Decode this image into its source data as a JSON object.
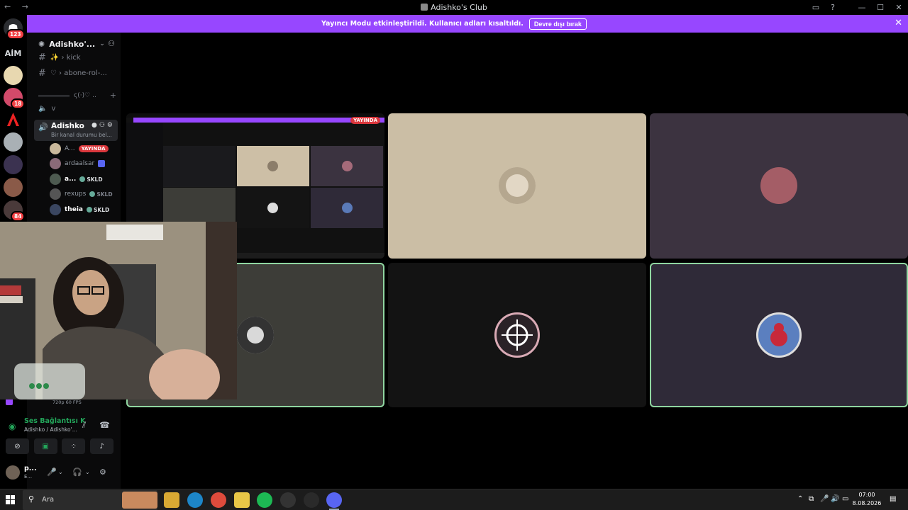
{
  "window": {
    "title": "Adishko's Club",
    "nav": "← →"
  },
  "banner": {
    "message": "Yayıncı Modu etkinleştirildi. Kullanıcı adları kısaltıldı.",
    "button": "Devre dışı bırak"
  },
  "rail": {
    "home_badge": "123",
    "aim_label": "AİM",
    "badge_18": "18",
    "badge_84": "84"
  },
  "server": {
    "name": "Adishko'...",
    "channels": [
      {
        "label": "✨ › kick"
      },
      {
        "label": "♡ › abone-rol-..."
      }
    ],
    "category": "ς(·)♡ ..",
    "voice_v": "v"
  },
  "voice_channel": {
    "name": "Adishko",
    "status": "Bir kanal durumu bel..."
  },
  "voice_users": [
    {
      "name": "A...",
      "tag": "YAYINDA"
    },
    {
      "name": "ardaalsar"
    },
    {
      "name": "a...",
      "tag": "SKLD"
    },
    {
      "name": "rexups",
      "tag": "SKLD"
    },
    {
      "name": "theia",
      "tag": "SKLD"
    }
  ],
  "stream_panel": {
    "quality": "720p 60 FPS"
  },
  "voice_connection": {
    "title": "Ses Bağlantısı K",
    "subtitle": "Adishko / Adishko'..."
  },
  "user_panel": {
    "name": "p...",
    "sub": "E..."
  },
  "live_label": "YAYINDA",
  "taskbar": {
    "search_placeholder": "Ara",
    "time": "07:00",
    "date": "8.08.2026"
  },
  "colors": {
    "banner": "#9747ff",
    "speaking": "#8fd6a0",
    "live": "#da373c",
    "connected": "#23a55a"
  }
}
